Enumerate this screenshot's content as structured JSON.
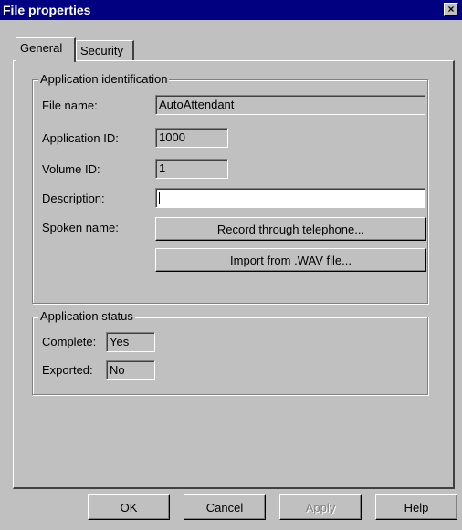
{
  "window": {
    "title": "File properties",
    "close_glyph": "×"
  },
  "tabs": [
    {
      "label": "General",
      "active": true
    },
    {
      "label": "Security",
      "active": false
    }
  ],
  "app_identification": {
    "legend": "Application identification",
    "file_name_label": "File name:",
    "file_name_value": "AutoAttendant",
    "app_id_label": "Application ID:",
    "app_id_value": "1000",
    "volume_id_label": "Volume ID:",
    "volume_id_value": "1",
    "description_label": "Description:",
    "description_value": "",
    "spoken_name_label": "Spoken name:",
    "record_button": "Record through telephone...",
    "import_button": "Import from .WAV file..."
  },
  "app_status": {
    "legend": "Application status",
    "complete_label": "Complete:",
    "complete_value": "Yes",
    "exported_label": "Exported:",
    "exported_value": "No"
  },
  "buttons": {
    "ok": "OK",
    "cancel": "Cancel",
    "apply": "Apply",
    "help": "Help"
  },
  "colors": {
    "title_bar": "#000080",
    "face": "#c0c0c0"
  }
}
